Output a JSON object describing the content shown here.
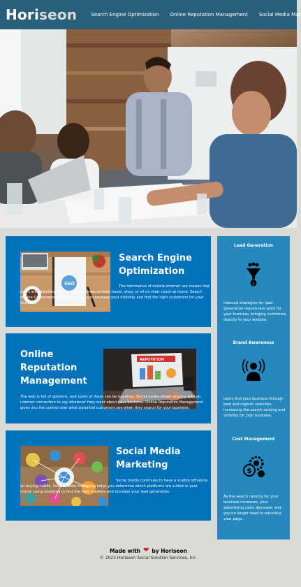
{
  "header": {
    "logo_main": "Hori",
    "logo_accent": "seon",
    "nav": [
      {
        "label": "Search Engine Optimization"
      },
      {
        "label": "Online Reputation Management"
      },
      {
        "label": "Social Media Marketing"
      }
    ]
  },
  "colors": {
    "header_bg": "#2a607c",
    "card_bg": "#0072bb",
    "sidebar_bg": "#2589bd",
    "page_bg": "#d9dcd6",
    "heart": "#d71a1a"
  },
  "sections": {
    "seo": {
      "title": "Search Engine Optimization",
      "body": "The dominance of mobile internet use means that users are searching for the right business as they travel, shop, or sit on their couch at home. Search Engine Optimization (SEO) allows you to increase your visibility and find the right customers for your business."
    },
    "orm": {
      "title": "Online Reputation Management",
      "body": "The web is full of opinions, and some of these can be negative. Social media allows anyone with an internet connection to say whatever they want about your business. Online Reputation Management gives you the control over what potential customers see when they search for your business."
    },
    "smm": {
      "title": "Social Media Marketing",
      "body": "Social media continues to have a sizable influence on buying habits. Social media marketing helps you determine which platforms are suited to your brand, using analytics to find the right markets and increase your lead generation."
    }
  },
  "benefits": {
    "lead": {
      "title": "Lead Generation",
      "icon": "lead-generation-icon",
      "body": "Inbound strategies for lead generation require less work for your business, bringing customers directly to your website."
    },
    "brand": {
      "title": "Brand Awareness",
      "icon": "brand-awareness-icon",
      "body": "Users find your business through paid and organic searches, increasing the search ranking and visibility for your business."
    },
    "cost": {
      "title": "Cost Management",
      "icon": "cost-management-icon",
      "body": "As the search ranking for your business increases, your advertising costs decrease, and you no longer need to advertise your page."
    }
  },
  "images": {
    "seo_screen_label": "SEO",
    "orm_screen_label": "REPUTATION"
  },
  "footer": {
    "made_prefix": "Made with",
    "made_suffix": "by Horiseon",
    "copyright": "© 2023 Horiseon Social Solution Services, Inc."
  }
}
